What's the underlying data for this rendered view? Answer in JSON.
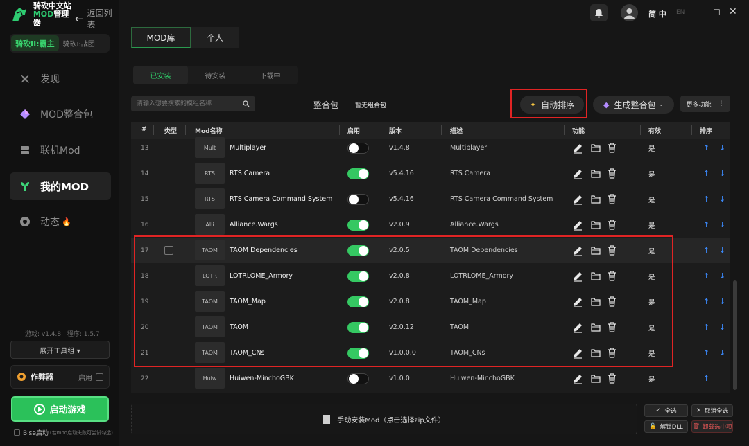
{
  "sidebar": {
    "logo_line1": "骑砍中文站",
    "logo_line2_accent": "MOD",
    "logo_line2_rest": "管理器",
    "back_label": "返回列表",
    "games": [
      "骑砍II:霸主",
      "骑砍I:战团"
    ],
    "nav": [
      {
        "label": "发现",
        "icon": "compass-icon"
      },
      {
        "label": "MOD整合包",
        "icon": "diamond-icon"
      },
      {
        "label": "联机Mod",
        "icon": "network-icon"
      },
      {
        "label": "我的MOD",
        "icon": "plant-icon"
      },
      {
        "label": "动态",
        "icon": "chat-icon"
      }
    ],
    "version_text": "游戏: v1.4.8 | 程序: 1.5.7",
    "tools_label": "展开工具组 ▾",
    "cheat_label": "作弊器",
    "cheat_enable": "启用",
    "start_label": "启动游戏",
    "bise_label": "Bise启动",
    "bise_hint": "(若mod启动失败可尝试勾选)"
  },
  "topbar": {
    "lang_zh": "简 中",
    "lang_en": "EN"
  },
  "tabs_main": [
    "MOD库",
    "个人"
  ],
  "tabs_sub": [
    "已安装",
    "待安装",
    "下载中"
  ],
  "toolbar": {
    "search_placeholder": "请输入想要搜索的模组名称",
    "pack_label": "整合包",
    "pack_value": "暂无组合包",
    "auto_sort": "自动排序",
    "gen_pack": "生成整合包",
    "more": "更多功能"
  },
  "table": {
    "headers": [
      "#",
      "类型",
      "Mod名称",
      "启用",
      "版本",
      "描述",
      "功能",
      "有效",
      "排序"
    ],
    "rows": [
      {
        "idx": "13",
        "thumb": "Mult",
        "name": "Multiplayer",
        "on": false,
        "ver": "v1.4.8",
        "desc": "Multiplayer",
        "valid": "是"
      },
      {
        "idx": "14",
        "thumb": "RTS",
        "name": "RTS Camera",
        "on": true,
        "ver": "v5.4.16",
        "desc": "RTS Camera",
        "valid": "是"
      },
      {
        "idx": "15",
        "thumb": "RTS",
        "name": "RTS Camera Command System",
        "on": false,
        "ver": "v5.4.16",
        "desc": "RTS Camera Command System",
        "valid": "是"
      },
      {
        "idx": "16",
        "thumb": "Alli",
        "name": "Alliance.Wargs",
        "on": true,
        "ver": "v2.0.9",
        "desc": "Alliance.Wargs",
        "valid": "是"
      },
      {
        "idx": "17",
        "thumb": "TAOM",
        "name": "TAOM Dependencies",
        "on": true,
        "ver": "v2.0.5",
        "desc": "TAOM Dependencies",
        "valid": "是"
      },
      {
        "idx": "18",
        "thumb": "LOTR",
        "name": "LOTRLOME_Armory",
        "on": true,
        "ver": "v2.0.8",
        "desc": "LOTRLOME_Armory",
        "valid": "是"
      },
      {
        "idx": "19",
        "thumb": "TAOM",
        "name": "TAOM_Map",
        "on": true,
        "ver": "v2.0.8",
        "desc": "TAOM_Map",
        "valid": "是"
      },
      {
        "idx": "20",
        "thumb": "TAOM",
        "name": "TAOM",
        "on": true,
        "ver": "v2.0.12",
        "desc": "TAOM",
        "valid": "是"
      },
      {
        "idx": "21",
        "thumb": "TAOM",
        "name": "TAOM_CNs",
        "on": true,
        "ver": "v1.0.0.0",
        "desc": "TAOM_CNs",
        "valid": "是"
      },
      {
        "idx": "22",
        "thumb": "Huiw",
        "name": "Huiwen-MinchoGBK",
        "on": false,
        "ver": "v1.0.0",
        "desc": "Huiwen-MinchoGBK",
        "valid": "是"
      }
    ]
  },
  "bottom": {
    "install_label": "手动安装Mod（点击选择zip文件）",
    "select_all": "全选",
    "cancel_all": "取消全选",
    "unlock_dll": "解锁DLL",
    "uninstall": "卸载选中项"
  },
  "colors": {
    "accent": "#2bc15a",
    "highlight": "#e02424",
    "arrow": "#3c8bff"
  }
}
